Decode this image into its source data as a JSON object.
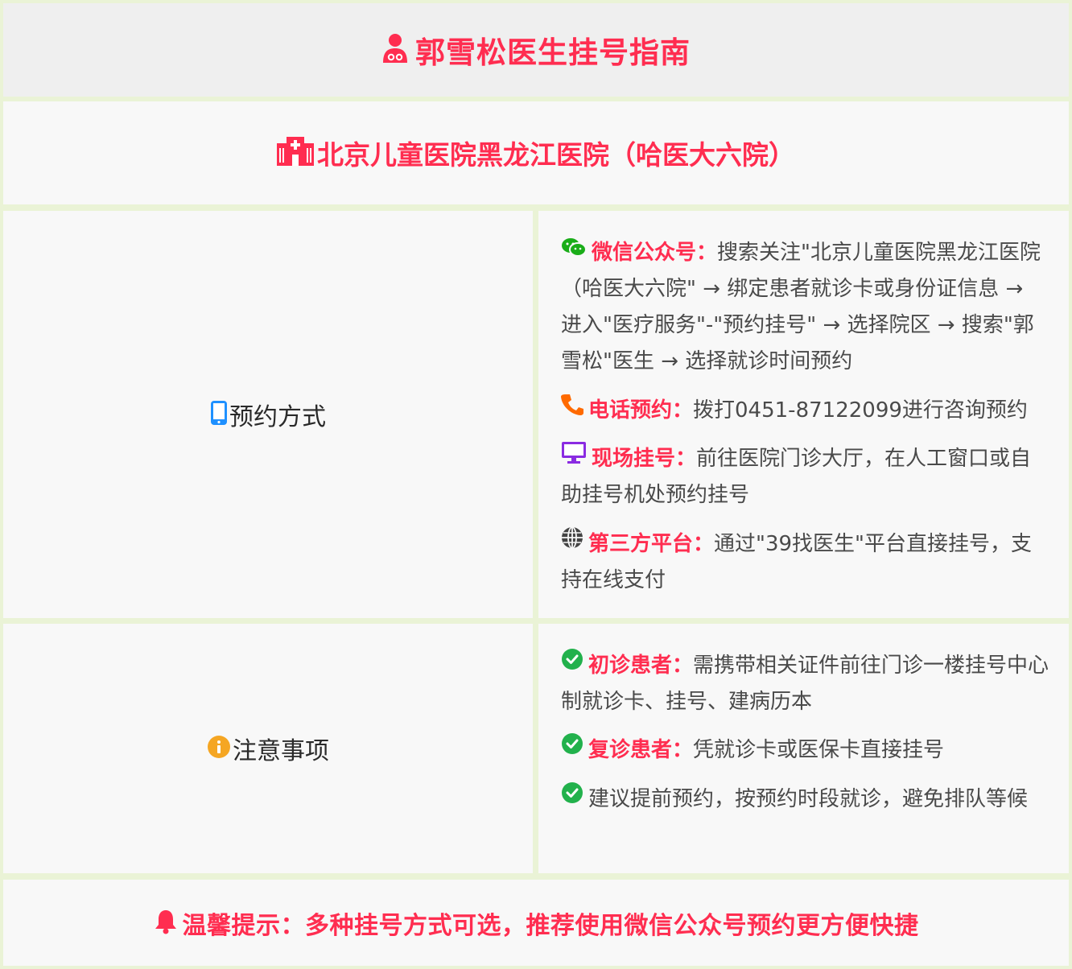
{
  "header": {
    "title": "郭雪松医生挂号指南"
  },
  "hospital": {
    "name": "北京儿童医院黑龙江医院（哈医大六院）"
  },
  "booking": {
    "label": "预约方式",
    "items": [
      {
        "key": "微信公众号：",
        "text": "搜索关注\"北京儿童医院黑龙江医院（哈医大六院\" → 绑定患者就诊卡或身份证信息 → 进入\"医疗服务\"-\"预约挂号\" → 选择院区 → 搜索\"郭雪松\"医生 → 选择就诊时间预约"
      },
      {
        "key": "电话预约：",
        "text": "拨打0451-87122099进行咨询预约"
      },
      {
        "key": "现场挂号：",
        "text": "前往医院门诊大厅，在人工窗口或自助挂号机处预约挂号"
      },
      {
        "key": "第三方平台：",
        "text": "通过\"39找医生\"平台直接挂号，支持在线支付"
      }
    ]
  },
  "notes": {
    "label": "注意事项",
    "items": [
      {
        "key": "初诊患者：",
        "text": "需携带相关证件前往门诊一楼挂号中心制就诊卡、挂号、建病历本"
      },
      {
        "key": "复诊患者：",
        "text": "凭就诊卡或医保卡直接挂号"
      },
      {
        "key": "",
        "text": "建议提前预约，按预约时段就诊，避免排队等候"
      }
    ]
  },
  "footer": {
    "tip": "温馨提示：多种挂号方式可选，推荐使用微信公众号预约更方便快捷"
  },
  "colors": {
    "accent": "#ff2d50",
    "border": "#eaf3d6",
    "cell": "#f8f8f8",
    "wechat": "#1aad19",
    "phone": "#ff6a00",
    "monitor": "#8a2be2",
    "check": "#22b14c",
    "info": "#f5a623",
    "mobile": "#1e90ff"
  }
}
